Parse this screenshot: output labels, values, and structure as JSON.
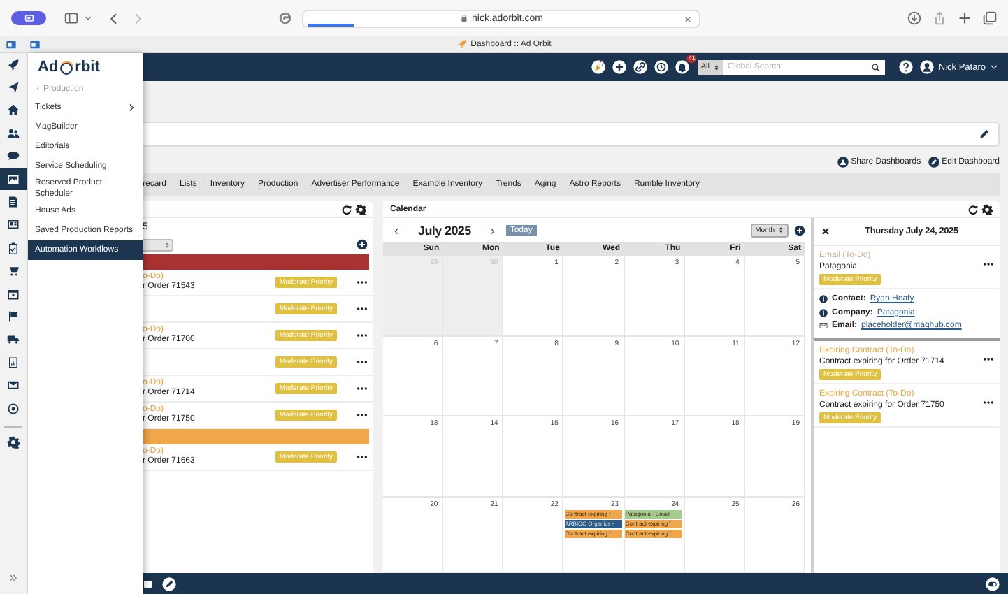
{
  "browser": {
    "url": "nick.adorbit.com",
    "tab_title": "Dashboard :: Ad Orbit",
    "page_load": {
      "level": 0.12
    }
  },
  "rail": {
    "items": [
      {
        "kind": "rocket",
        "selected": false
      },
      {
        "kind": "plane",
        "selected": false
      },
      {
        "kind": "home",
        "selected": false
      },
      {
        "kind": "users",
        "selected": false
      },
      {
        "kind": "chat",
        "selected": false
      },
      {
        "kind": "picture",
        "selected": true
      },
      {
        "kind": "document",
        "selected": false
      },
      {
        "kind": "card",
        "selected": false
      },
      {
        "kind": "clipboard",
        "selected": false
      },
      {
        "kind": "cart",
        "selected": false
      },
      {
        "kind": "calendar",
        "selected": false
      },
      {
        "kind": "flag",
        "selected": false
      },
      {
        "kind": "truck",
        "selected": false
      },
      {
        "kind": "report",
        "selected": false
      },
      {
        "kind": "envelope",
        "selected": false
      },
      {
        "kind": "globe",
        "selected": false
      },
      {
        "kind": "gear",
        "selected": false
      }
    ],
    "expand": "»"
  },
  "menu": {
    "logo_start": "Ad",
    "logo_end": "rbit",
    "back_arrow": "‹",
    "section": "Production",
    "items": [
      {
        "label": "Tickets",
        "has_submenu": true,
        "selected": false
      },
      {
        "label": "MagBuilder",
        "has_submenu": false,
        "selected": false
      },
      {
        "label": "Editorials",
        "has_submenu": false,
        "selected": false
      },
      {
        "label": "Service Scheduling",
        "has_submenu": false,
        "selected": false
      },
      {
        "label": "Reserved Product Scheduler",
        "has_submenu": false,
        "selected": false
      },
      {
        "label": "House Ads",
        "has_submenu": false,
        "selected": false
      },
      {
        "label": "Saved Production Reports",
        "has_submenu": false,
        "selected": false
      },
      {
        "label": "Automation Workflows",
        "has_submenu": false,
        "selected": true
      }
    ]
  },
  "header": {
    "notification_count": "41",
    "search_scope": "All",
    "search_placeholder": "Global Search",
    "user_name": "Nick Pataro"
  },
  "dashboard": {
    "actions": [
      {
        "kind": "share",
        "label": "Share Dashboards"
      },
      {
        "kind": "edit",
        "label": "Edit Dashboard"
      }
    ],
    "tabs": [
      {
        "label": "recard",
        "selected": false
      },
      {
        "label": "Lists",
        "selected": false
      },
      {
        "label": "Inventory",
        "selected": false
      },
      {
        "label": "Production",
        "selected": false
      },
      {
        "label": "Advertiser Performance",
        "selected": false
      },
      {
        "label": "Example Inventory",
        "selected": false
      },
      {
        "label": "Trends",
        "selected": false
      },
      {
        "label": "Aging",
        "selected": false
      },
      {
        "label": "Astro Reports",
        "selected": false
      },
      {
        "label": "Rumble Inventory",
        "selected": false
      }
    ]
  },
  "task_widget": {
    "title": "5",
    "rows": [
      {
        "kind": "group",
        "color": "#a83232"
      },
      {
        "kind": "task",
        "type": "o-Do)",
        "title": "r Order 71543",
        "badge": "Moderate Priority"
      },
      {
        "kind": "task",
        "badge": "Moderate Priority"
      },
      {
        "kind": "task",
        "type": "o-Do)",
        "title": "r Order 71700",
        "badge": "Moderate Priority"
      },
      {
        "kind": "task",
        "badge": "Moderate Priority"
      },
      {
        "kind": "task",
        "type": "o-Do)",
        "title": "r Order 71714",
        "badge": "Moderate Priority"
      },
      {
        "kind": "task",
        "type": "o-Do)",
        "title": "r Order 71750",
        "badge": "Moderate Priority"
      },
      {
        "kind": "group",
        "color": "#f0a64a"
      },
      {
        "kind": "task",
        "type": "o-Do)",
        "title": "r Order 71663",
        "badge": "Moderate Priority"
      }
    ]
  },
  "calendar": {
    "title": "Calendar",
    "prev": "‹",
    "month": "July 2025",
    "next": "›",
    "today": "Today",
    "view": "Month",
    "weekdays": [
      "Sun",
      "Mon",
      "Tue",
      "Wed",
      "Thu",
      "Fri",
      "Sat"
    ],
    "weeks": [
      [
        {
          "day": "29",
          "other_month": true
        },
        {
          "day": "30",
          "other_month": true
        },
        {
          "day": "1",
          "other_month": false
        },
        {
          "day": "2",
          "other_month": false
        },
        {
          "day": "3",
          "other_month": false
        },
        {
          "day": "4",
          "other_month": false
        },
        {
          "day": "5",
          "other_month": false
        }
      ],
      [
        {
          "day": "6",
          "other_month": false
        },
        {
          "day": "7",
          "other_month": false
        },
        {
          "day": "8",
          "other_month": false
        },
        {
          "day": "9",
          "other_month": false
        },
        {
          "day": "10",
          "other_month": false
        },
        {
          "day": "11",
          "other_month": false
        },
        {
          "day": "12",
          "other_month": false
        }
      ],
      [
        {
          "day": "13",
          "other_month": false
        },
        {
          "day": "14",
          "other_month": false
        },
        {
          "day": "15",
          "other_month": false
        },
        {
          "day": "16",
          "other_month": false
        },
        {
          "day": "17",
          "other_month": false
        },
        {
          "day": "18",
          "other_month": false
        },
        {
          "day": "19",
          "other_month": false
        }
      ],
      [
        {
          "day": "20",
          "other_month": false
        },
        {
          "day": "21",
          "other_month": false
        },
        {
          "day": "22",
          "other_month": false
        },
        {
          "day": "23",
          "other_month": false,
          "events": [
            {
              "label": "Contract expiring f",
              "color": "#f0a64a"
            },
            {
              "label": "ARBICO Organics -",
              "color": "#2c5a86"
            },
            {
              "label": "Contract expiring f",
              "color": "#f0a64a"
            }
          ]
        },
        {
          "day": "24",
          "other_month": false,
          "events": [
            {
              "label": "Patagonia - Email",
              "color": "#a3cc8e"
            },
            {
              "label": "Contract expiring f",
              "color": "#f0a64a"
            },
            {
              "label": "Contract expiring f",
              "color": "#f0a64a"
            }
          ]
        },
        {
          "day": "25",
          "other_month": false
        },
        {
          "day": "26",
          "other_month": false
        }
      ]
    ]
  },
  "detail": {
    "date": "Thursday July 24, 2025",
    "items": [
      {
        "type": "Email (To-Do)",
        "color": "#c9b497",
        "title": "Patagonia",
        "badge": "Moderate Priority",
        "details": [
          {
            "kind": "info",
            "label": "Contact:",
            "value": "Ryan Heafy"
          },
          {
            "kind": "info",
            "label": "Company:",
            "value": "Patagonia"
          },
          {
            "kind": "mail",
            "label": "Email:",
            "value": "placeholder@maghub.com"
          }
        ]
      },
      {
        "type": "Expiring Contract (To-Do)",
        "color": "#eea842",
        "title": "Contract expiring for Order 71714",
        "badge": "Moderate Priority"
      },
      {
        "type": "Expiring Contract (To-Do)",
        "color": "#eea842",
        "title": "Contract expiring for Order 71750",
        "badge": "Moderate Priority"
      }
    ]
  }
}
